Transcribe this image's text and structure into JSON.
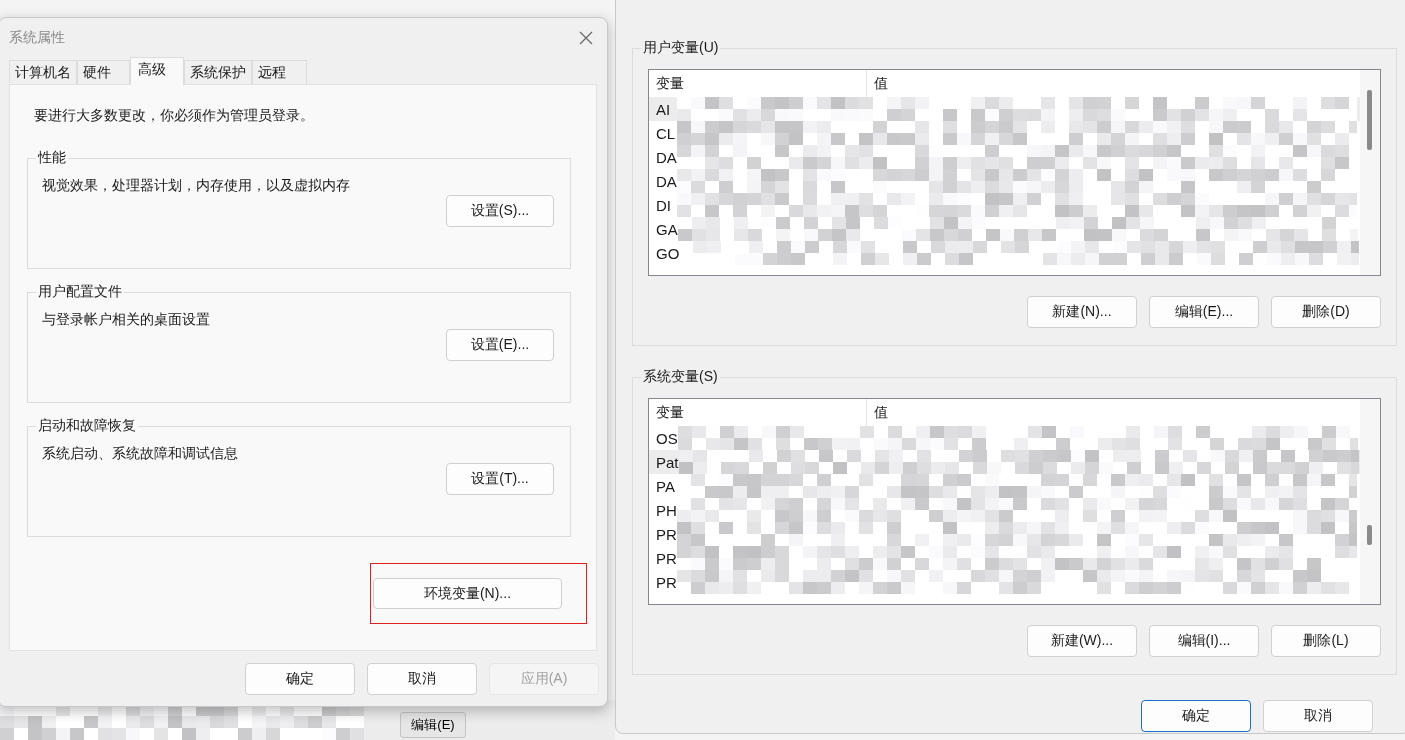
{
  "system_properties": {
    "title": "系统属性",
    "tabs": [
      {
        "label": "计算机名",
        "selected": false
      },
      {
        "label": "硬件",
        "selected": false
      },
      {
        "label": "高级",
        "selected": true
      },
      {
        "label": "系统保护",
        "selected": false
      },
      {
        "label": "远程",
        "selected": false
      }
    ],
    "notice": "要进行大多数更改，你必须作为管理员登录。",
    "groups": [
      {
        "title": "性能",
        "description": "视觉效果，处理器计划，内存使用，以及虚拟内存",
        "button": "设置(S)..."
      },
      {
        "title": "用户配置文件",
        "description": "与登录帐户相关的桌面设置",
        "button": "设置(E)..."
      },
      {
        "title": "启动和故障恢复",
        "description": "系统启动、系统故障和调试信息",
        "button": "设置(T)..."
      }
    ],
    "env_button": {
      "label": "环境变量(N)...",
      "highlighted": true
    },
    "buttons": [
      {
        "label": "确定",
        "disabled": false
      },
      {
        "label": "取消",
        "disabled": false
      },
      {
        "label": "应用(A)",
        "disabled": true
      }
    ]
  },
  "environment_variables": {
    "groups": [
      {
        "title": "用户变量(U)",
        "columns": [
          "变量",
          "值"
        ],
        "rows": [
          {
            "name": "AI",
            "selected": true
          },
          {
            "name": "CL",
            "selected": false
          },
          {
            "name": "DA",
            "selected": false
          },
          {
            "name": "DA",
            "selected": false
          },
          {
            "name": "DI",
            "selected": false
          },
          {
            "name": "GA",
            "selected": false
          },
          {
            "name": "GO",
            "selected": false
          }
        ],
        "buttons": [
          "新建(N)...",
          "编辑(E)...",
          "删除(D)"
        ]
      },
      {
        "title": "系统变量(S)",
        "columns": [
          "变量",
          "值"
        ],
        "rows": [
          {
            "name": "OS",
            "selected": false
          },
          {
            "name": "Pat",
            "selected": true
          },
          {
            "name": "PA",
            "selected": false
          },
          {
            "name": "PH",
            "selected": false
          },
          {
            "name": "PR",
            "selected": false
          },
          {
            "name": "PR",
            "selected": false
          },
          {
            "name": "PR",
            "selected": false
          }
        ],
        "buttons": [
          "新建(W)...",
          "编辑(I)...",
          "删除(L)"
        ]
      }
    ],
    "buttons": [
      {
        "label": "确定",
        "default": true
      },
      {
        "label": "取消",
        "default": false
      }
    ]
  },
  "background": {
    "button": "编辑(E)"
  }
}
